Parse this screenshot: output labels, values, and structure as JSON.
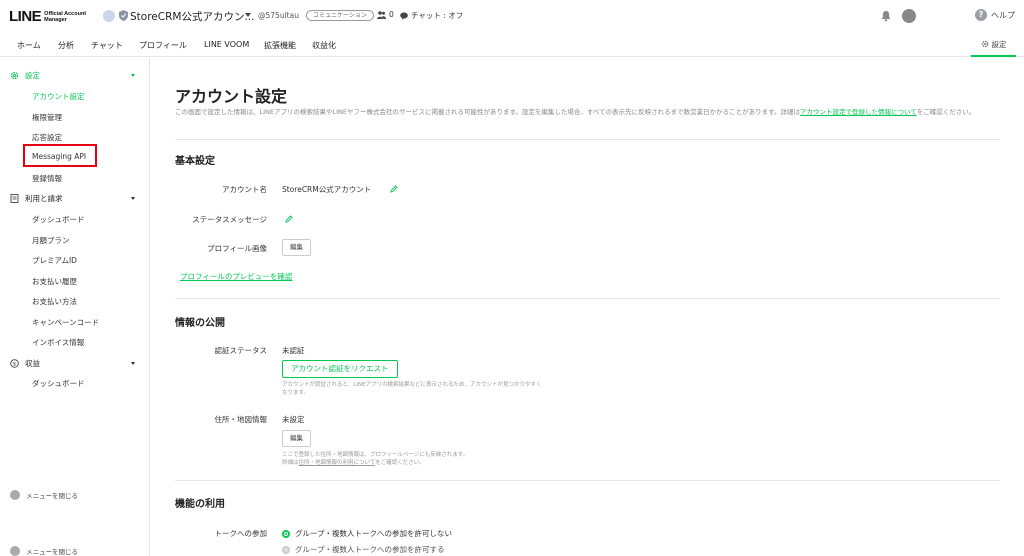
{
  "header": {
    "logo_main": "LINE",
    "logo_sub_1": "Official Account",
    "logo_sub_2": "Manager",
    "account_name": "StoreCRM公式アカウン...",
    "account_id": "@575ultau",
    "plan_badge": "コミュニケーション",
    "friend_count": "0",
    "chat_status": "チャット : オフ",
    "help_label": "ヘルプ",
    "help_icon_glyph": "?"
  },
  "nav": {
    "items": [
      "ホーム",
      "分析",
      "チャット",
      "プロフィール",
      "LINE VOOM",
      "拡張機能",
      "収益化"
    ],
    "settings_label": "設定"
  },
  "sidebar": {
    "settings_section": "設定",
    "settings_items": [
      "アカウント設定",
      "権限管理",
      "応答設定",
      "Messaging API",
      "登録情報"
    ],
    "billing_section": "利用と請求",
    "billing_items": [
      "ダッシュボード",
      "月額プラン",
      "プレミアムID",
      "お支払い履歴",
      "お支払い方法",
      "キャンペーンコード",
      "インボイス情報"
    ],
    "revenue_section": "収益",
    "revenue_items": [
      "ダッシュボード"
    ],
    "collapse_label": "メニューを閉じる",
    "collapse_label_2": "メニューを閉じる"
  },
  "main": {
    "title": "アカウント設定",
    "description": "この画面で設定した情報は、LINEアプリの検索結果やLINEヤフー株式会社のサービスに掲載される可能性があります。設定を編集した場合、すべての表示先に反映されるまで数営業日かかることがあります。詳細は",
    "description_link": "アカウント設定で登録した情報について",
    "description_tail": "をご確認ください。",
    "basic": {
      "title": "基本設定",
      "account_name_label": "アカウント名",
      "account_name_value": "StoreCRM公式アカウント",
      "status_label": "ステータスメッセージ",
      "profile_image_label": "プロフィール画像",
      "edit_button": "編集",
      "preview_link": "プロフィールのプレビューを確認"
    },
    "publish": {
      "title": "情報の公開",
      "verify_label": "認証ステータス",
      "verify_value": "未認証",
      "verify_button": "アカウント認証をリクエスト",
      "verify_help_1": "アカウントが認証されると、LINEアプリの検索結果などに表示されるため、アカウントが見つかりやすく",
      "verify_help_2": "なります。",
      "address_label": "住所・地図情報",
      "address_value": "未設定",
      "edit_button": "編集",
      "address_help_1": "ここで登録した住所・地図情報は、プロフィールページにも反映されます。",
      "address_help_2a": "詳細は",
      "address_help_link": "住所・地図情報の利用について",
      "address_help_2b": "をご確認ください。"
    },
    "features": {
      "title": "機能の利用",
      "talk_join_label": "トークへの参加",
      "option_deny": "グループ・複数人トークへの参加を許可しない",
      "option_allow": "グループ・複数人トークへの参加を許可する"
    }
  },
  "colors": {
    "accent": "#06c755",
    "highlight": "#e60012"
  }
}
